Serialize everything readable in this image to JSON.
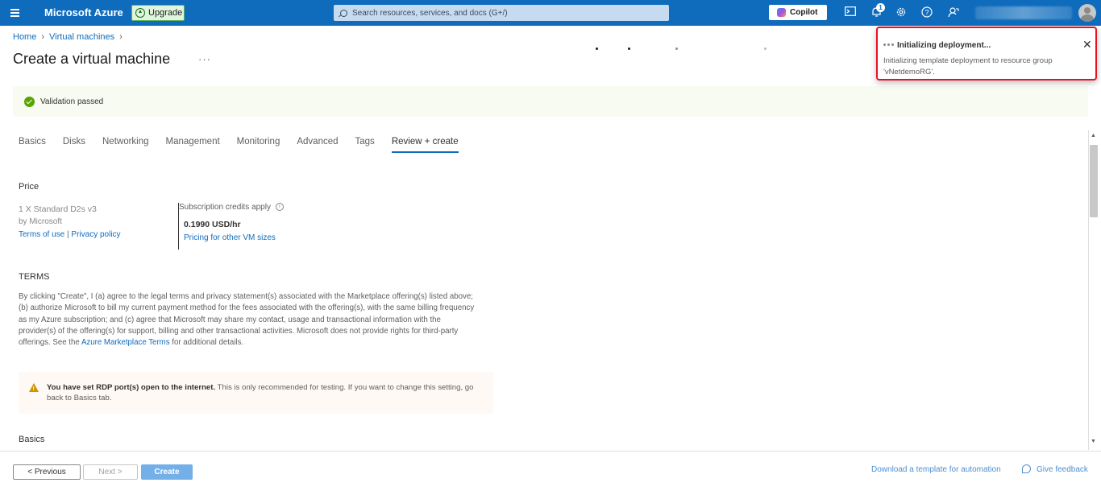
{
  "topbar": {
    "brand": "Microsoft Azure",
    "upgrade_label": "Upgrade",
    "search_placeholder": "Search resources, services, and docs (G+/)",
    "copilot_label": "Copilot",
    "notification_count": "1"
  },
  "breadcrumb": {
    "items": [
      "Home",
      "Virtual machines"
    ]
  },
  "page": {
    "title": "Create a virtual machine",
    "more": "···"
  },
  "validation": {
    "text": "Validation passed"
  },
  "tabs": [
    "Basics",
    "Disks",
    "Networking",
    "Management",
    "Monitoring",
    "Advanced",
    "Tags",
    "Review + create"
  ],
  "active_tab": "Review + create",
  "price": {
    "heading": "Price",
    "product": "1 X Standard D2s v3",
    "publisher": "by Microsoft",
    "terms_link": "Terms of use",
    "separator": "|",
    "privacy_link": "Privacy policy",
    "credits_label": "Subscription credits apply",
    "rate": "0.1990 USD/hr",
    "pricing_link": "Pricing for other VM sizes"
  },
  "terms": {
    "heading": "TERMS",
    "body_before_link": "By clicking \"Create\", I (a) agree to the legal terms and privacy statement(s) associated with the Marketplace offering(s) listed above; (b) authorize Microsoft to bill my current payment method for the fees associated with the offering(s), with the same billing frequency as my Azure subscription; and (c) agree that Microsoft may share my contact, usage and transactional information with the provider(s) of the offering(s) for support, billing and other transactional activities. Microsoft does not provide rights for third-party offerings. See the",
    "link": "Azure Marketplace Terms",
    "body_after_link": "for additional details."
  },
  "warning": {
    "bold": "You have set RDP port(s) open to the internet.",
    "text": "This is only recommended for testing.  If you want to change this setting, go back to Basics tab."
  },
  "basics_heading": "Basics",
  "footer": {
    "previous": "< Previous",
    "next": "Next >",
    "create": "Create",
    "download_template": "Download a template for automation",
    "feedback": "Give feedback"
  },
  "toast": {
    "title": "Initializing deployment...",
    "body": "Initializing template deployment to resource group 'vNetdemoRG'."
  },
  "colors": {
    "topbar": "#0f6cbd",
    "accent": "#0f6cbd",
    "success": "#57a300",
    "warning": "#d29200",
    "highlight": "#e81123"
  }
}
